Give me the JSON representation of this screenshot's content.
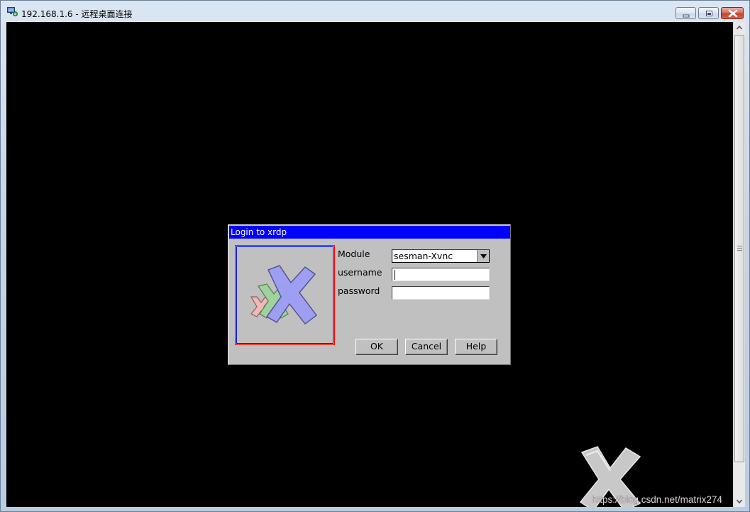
{
  "window": {
    "title": "192.168.1.6 - 远程桌面连接"
  },
  "dialog": {
    "title": "Login to xrdp",
    "module_label": "Module",
    "module_value": "sesman-Xvnc",
    "username_label": "username",
    "username_value": "",
    "password_label": "password",
    "password_value": "",
    "ok_label": "OK",
    "cancel_label": "Cancel",
    "help_label": "Help"
  },
  "watermark": {
    "text": "https://blog.csdn.net/matrix274"
  },
  "icons": {
    "app": "remote-desktop-icon",
    "logo": "xrdp-logo",
    "dropdown": "dropdown-arrow-icon"
  },
  "colors": {
    "dialog_title_bg": "#0000ff",
    "dialog_bg": "#c0c0c0",
    "desktop_bg": "#000000"
  }
}
